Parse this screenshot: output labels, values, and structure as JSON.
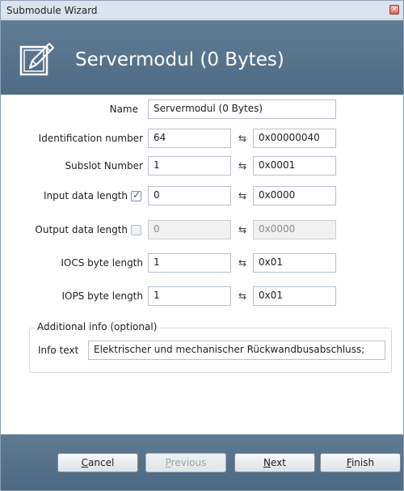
{
  "window": {
    "title": "Submodule Wizard",
    "close_glyph": "✕"
  },
  "header": {
    "icon": "edit-icon",
    "title": "Servermodul (0 Bytes)"
  },
  "form": {
    "name": {
      "label": "Name",
      "value": "Servermodul (0 Bytes)"
    },
    "identification_number": {
      "label": "Identification number",
      "value": "64",
      "hex": "0x00000040"
    },
    "subslot_number": {
      "label": "Subslot Number",
      "value": "1",
      "hex": "0x0001"
    },
    "input_data_length": {
      "label": "Input data length",
      "checked": true,
      "value": "0",
      "hex": "0x0000"
    },
    "output_data_length": {
      "label": "Output data length",
      "checked": false,
      "value": "0",
      "hex": "0x0000"
    },
    "iocs_byte_length": {
      "label": "IOCS byte length",
      "value": "1",
      "hex": "0x01"
    },
    "iops_byte_length": {
      "label": "IOPS byte length",
      "value": "1",
      "hex": "0x01"
    },
    "swap_glyph": "⇆"
  },
  "additional_info": {
    "legend": "Additional info (optional)",
    "info_label": "Info text",
    "info_value": "Elektrischer und mechanischer Rückwandbusabschluss;"
  },
  "buttons": {
    "cancel": {
      "mnemonic": "C",
      "rest": "ancel"
    },
    "previous": {
      "mnemonic": "P",
      "rest": "revious"
    },
    "next": {
      "mnemonic": "N",
      "rest": "ext"
    },
    "finish": {
      "mnemonic": "F",
      "rest": "inish"
    }
  },
  "colors": {
    "header_bg": "#5b778f",
    "titlebar_bg": "#dbe4ee",
    "content_bg": "#ffffff"
  }
}
